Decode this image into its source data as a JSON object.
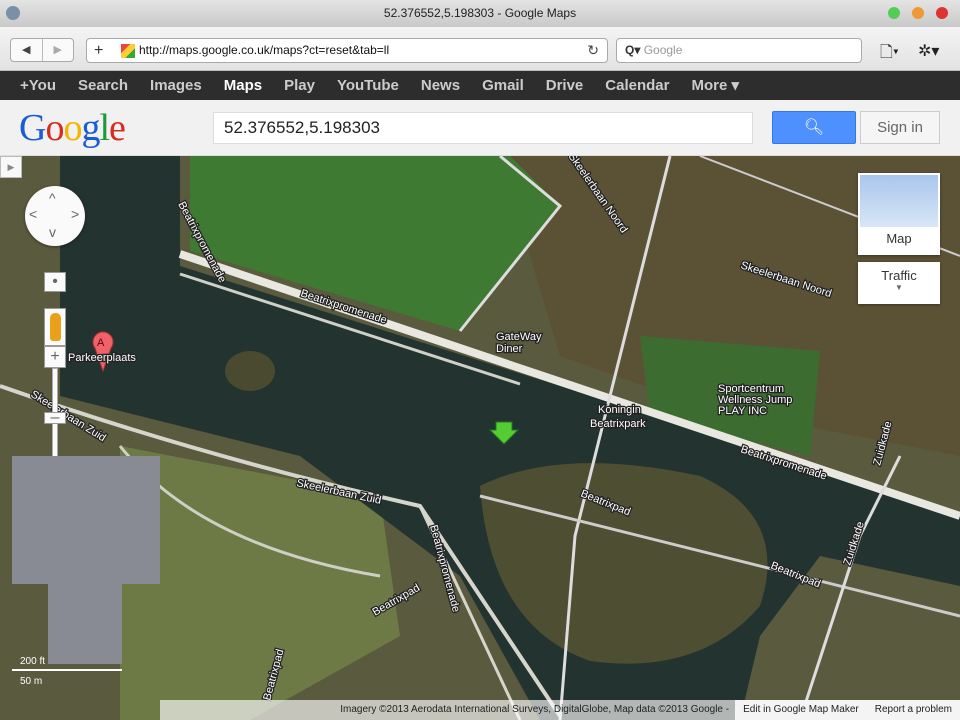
{
  "window": {
    "title": "52.376552,5.198303 - Google Maps"
  },
  "toolbar": {
    "url": "http://maps.google.co.uk/maps?ct=reset&tab=ll",
    "search_placeholder": "Google",
    "back": "◀",
    "forward": "▶",
    "plus": "+",
    "reload": "↻",
    "page_icon": "🗋▾",
    "gear_icon": "✲▾"
  },
  "gbar": {
    "items": [
      "+You",
      "Search",
      "Images",
      "Maps",
      "Play",
      "YouTube",
      "News",
      "Gmail",
      "Drive",
      "Calendar",
      "More ▾"
    ]
  },
  "header": {
    "query": "52.376552,5.198303",
    "signin": "Sign in"
  },
  "map": {
    "type_label": "Map",
    "traffic_label": "Traffic",
    "marker_letter": "A",
    "marker_label": "Parkeerplaats",
    "labels": {
      "promenade1": "Beatrixpromenade",
      "promenade2": "Beatrixpromenade",
      "promenade3": "Beatrixpromenade",
      "promenade4": "Beatrixpromenade",
      "noord1": "Skeelerbaan Noord",
      "noord2": "Skeelerbaan Noord",
      "zuid1": "Skeelerbaan Zuid",
      "zuid2": "Skeelerbaan Zuid",
      "pad1": "Beatrixpad",
      "pad2": "Beatrixpad",
      "pad3": "Beatrixpad",
      "pad4": "Beatrixpad",
      "diner1": "GateWay",
      "diner2": "Diner",
      "park1": "Koningin",
      "park2": "Beatrixpark",
      "sport1": "Sportcentrum",
      "sport2": "Wellness Jump",
      "sport3": "PLAY INC",
      "kade": "Zuidkade",
      "kade2": "Zuidkade"
    },
    "scale_ft": "200 ft",
    "scale_m": "50 m"
  },
  "footer": {
    "attribution": "Imagery ©2013 Aerodata International Surveys, DigitalGlobe, Map data ©2013 Google -",
    "edit": "Edit in Google Map Maker",
    "report": "Report a problem"
  }
}
